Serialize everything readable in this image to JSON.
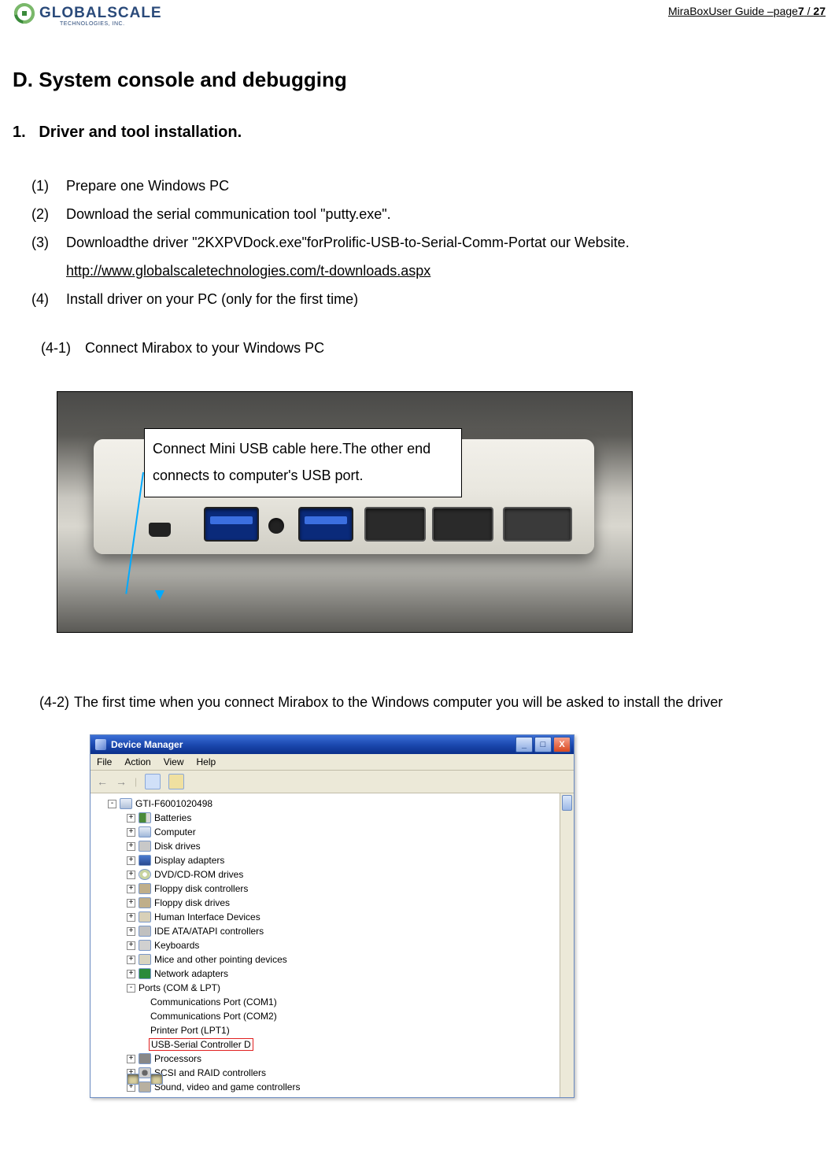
{
  "header": {
    "logo_text": "GLOBALSCALE",
    "logo_sub": "TECHNOLOGIES, INC.",
    "guide_prefix": "MiraBoxUser Guide –page",
    "page_current": "7",
    "page_sep": " / ",
    "page_total": "27"
  },
  "section": {
    "letter": "D.",
    "title": "System console and debugging"
  },
  "subsection": {
    "number": "1.",
    "title": "Driver and tool installation."
  },
  "steps": [
    {
      "num": "(1)",
      "text": "Prepare one Windows PC"
    },
    {
      "num": "(2)",
      "text": "Download the serial communication tool \"putty.exe\"."
    },
    {
      "num": "(3)",
      "text": "Downloadthe driver \"2KXPVDock.exe\"forProlific-USB-to-Serial-Comm-Portat our Website."
    },
    {
      "num": "(4)",
      "text": "Install driver on your PC (only for the first time)"
    }
  ],
  "download_link": "http://www.globalscaletechnologies.com/t-downloads.aspx",
  "substeps": {
    "s41": {
      "num": "(4-1)",
      "text": "Connect Mirabox to your Windows PC"
    },
    "s42": {
      "num": "(4-2)",
      "text": "The first time when you connect Mirabox to the Windows computer you will be asked to install the driver"
    }
  },
  "callout": {
    "line1": "Connect Mini USB cable here.The other end",
    "line2": "connects to computer's USB port."
  },
  "device_manager": {
    "title": "Device Manager",
    "menu": [
      "File",
      "Action",
      "View",
      "Help"
    ],
    "window_buttons": {
      "min": "_",
      "max": "□",
      "close": "X"
    },
    "root": "GTI-F6001020498",
    "nodes": [
      {
        "exp": "+",
        "icon": "batt",
        "label": "Batteries"
      },
      {
        "exp": "+",
        "icon": "comp",
        "label": "Computer"
      },
      {
        "exp": "+",
        "icon": "disk",
        "label": "Disk drives"
      },
      {
        "exp": "+",
        "icon": "disp",
        "label": "Display adapters"
      },
      {
        "exp": "+",
        "icon": "dvd",
        "label": "DVD/CD-ROM drives"
      },
      {
        "exp": "+",
        "icon": "floppy",
        "label": "Floppy disk controllers"
      },
      {
        "exp": "+",
        "icon": "floppy",
        "label": "Floppy disk drives"
      },
      {
        "exp": "+",
        "icon": "hid",
        "label": "Human Interface Devices"
      },
      {
        "exp": "+",
        "icon": "ide",
        "label": "IDE ATA/ATAPI controllers"
      },
      {
        "exp": "+",
        "icon": "kbd",
        "label": "Keyboards"
      },
      {
        "exp": "+",
        "icon": "mouse",
        "label": "Mice and other pointing devices"
      },
      {
        "exp": "+",
        "icon": "net",
        "label": "Network adapters"
      }
    ],
    "ports": {
      "exp": "-",
      "label": "Ports (COM & LPT)",
      "children": [
        "Communications Port (COM1)",
        "Communications Port (COM2)",
        "Printer Port (LPT1)",
        "USB-Serial Controller D"
      ]
    },
    "after_ports": [
      {
        "exp": "+",
        "icon": "proc",
        "label": "Processors"
      },
      {
        "exp": "+",
        "icon": "scsi",
        "label": "SCSI and RAID controllers"
      },
      {
        "exp": "+",
        "icon": "sound",
        "label": "Sound, video and game controllers"
      }
    ]
  }
}
